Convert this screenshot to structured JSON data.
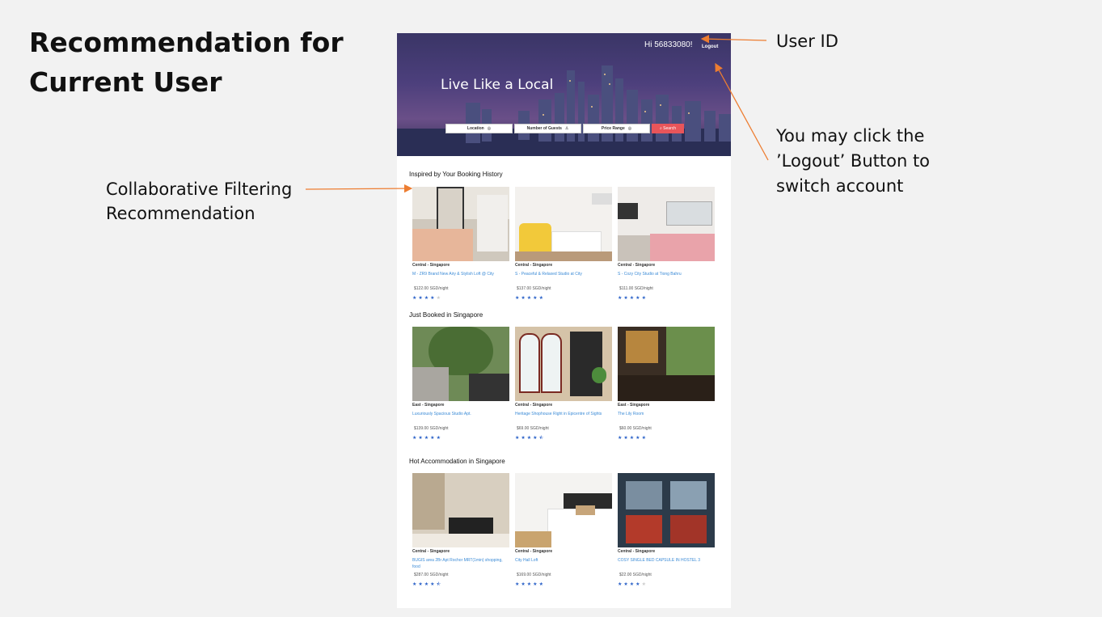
{
  "slide": {
    "title": "Recommendation for\n Current User",
    "notes": {
      "cf": "Collaborative Filtering\nRecommendation",
      "user_id": "User ID",
      "logout": "You may click the\n’Logout’ Button to\nswitch account"
    },
    "arrow_color": "#ed7d31"
  },
  "app": {
    "greeting": "Hi 56833080!",
    "logout_label": "Logout",
    "hero_title": "Live Like a Local",
    "search": {
      "location_label": "Location",
      "guests_label": "Number of Guests",
      "price_label": "Price Range",
      "button_label": "Search"
    },
    "sections": [
      {
        "title": "Inspired by Your Booking History",
        "cards": [
          {
            "location": "Central - Singapore",
            "name": "M - ZR9 Brand New Airy & Stylish Loft @ City",
            "price": "$122.00 SGD/night",
            "rating": 4,
            "photo": "bedroom-glass"
          },
          {
            "location": "Central - Singapore",
            "name": "S - Peaceful & Relaxed Studio at City",
            "price": "$137.00 SGD/night",
            "rating": 5,
            "photo": "studio-yellow"
          },
          {
            "location": "Central - Singapore",
            "name": "S - Cozy City Studio at Tiong Bahru",
            "price": "$111.00 SGD/night",
            "rating": 5,
            "photo": "studio-pink"
          }
        ]
      },
      {
        "title": "Just Booked in Singapore",
        "cards": [
          {
            "location": "East - Singapore",
            "name": "Luxuriously Spacious Studio Apt.",
            "price": "$139.00 SGD/night",
            "rating": 5,
            "photo": "garden"
          },
          {
            "location": "Central - Singapore",
            "name": "Heritage Shophouse Right in Epicentre of Sights",
            "price": "$69.00 SGD/night",
            "rating": 4.5,
            "photo": "shophouse"
          },
          {
            "location": "East - Singapore",
            "name": "The Lily Room",
            "price": "$60.00 SGD/night",
            "rating": 5,
            "photo": "lily-room"
          }
        ]
      },
      {
        "title": "Hot Accommodation in Singapore",
        "cards": [
          {
            "location": "Central - Singapore",
            "name": "BUGIS area 2Br Apt Rochor MRT(1min) shopping, food",
            "price": "$287.00 SGD/night",
            "rating": 4.5,
            "photo": "apartment"
          },
          {
            "location": "Central - Singapore",
            "name": "City Hall Loft",
            "price": "$169.00 SGD/night",
            "rating": 5,
            "photo": "loft"
          },
          {
            "location": "Central - Singapore",
            "name": "COSY SINGLE BED CAPSULE IN HOSTEL 3",
            "price": "$22.00 SGD/night",
            "rating": 4,
            "photo": "capsule"
          }
        ]
      }
    ]
  }
}
